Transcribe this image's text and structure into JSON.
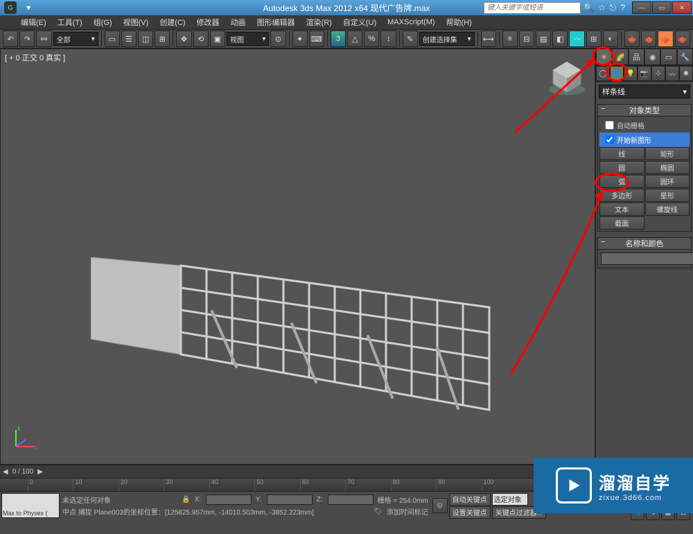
{
  "title": "Autodesk 3ds Max 2012 x64    现代广告牌.max",
  "search_placeholder": "键入关键字或短语",
  "menu": [
    "编辑(E)",
    "工具(T)",
    "组(G)",
    "视图(V)",
    "创建(C)",
    "修改器",
    "动画",
    "图形编辑器",
    "渲染(R)",
    "自定义(U)",
    "MAXScript(M)",
    "帮助(H)"
  ],
  "toolbar_dropdown_all": "全部",
  "toolbar_view": "视图",
  "toolbar_selset": "创建选择集",
  "viewport_label": "[ + 0 正交 0 真实 ]",
  "cmd": {
    "dropdown": "样条线",
    "objecttype_title": "对象类型",
    "autogrid": "自动栅格",
    "startnew": "开始新图形",
    "buttons": [
      [
        "线",
        "矩形"
      ],
      [
        "圆",
        "椭圆"
      ],
      [
        "弧",
        "圆环"
      ],
      [
        "多边形",
        "星形"
      ],
      [
        "文本",
        "螺旋线"
      ],
      [
        "截面",
        ""
      ]
    ],
    "namecolor_title": "名称和颜色"
  },
  "timeslider": {
    "frame": "0 / 100"
  },
  "trackbar_marks": [
    "0",
    "10",
    "20",
    "30",
    "40",
    "50",
    "60",
    "70",
    "80",
    "90",
    "100"
  ],
  "status": {
    "script_btn": "Max to Physex (",
    "line1": "未选定任何对象",
    "line2_prefix": "中点 捕捉 Plane003的坐标位置：",
    "line2_coords": "[125825.957mm, -14010.503mm, -3852.223mm]",
    "X": "X:",
    "Y": "Y:",
    "Z": "Z:",
    "grid_label": "栅格 = 254.0mm",
    "addtime": "添加时间标记",
    "autokey": "自动关键点",
    "selset": "选定对象",
    "setkey": "设置关键点",
    "keyfilter": "关键点过滤器..."
  },
  "watermark": {
    "brand": "溜溜自学",
    "url": "zixue.3d66.com"
  }
}
